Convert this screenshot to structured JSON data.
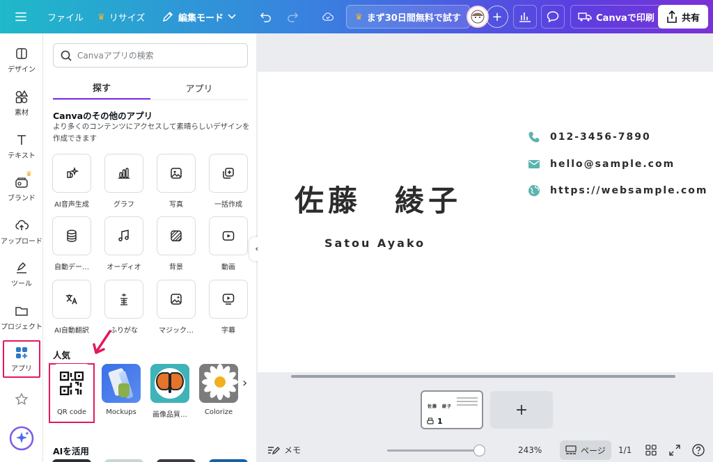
{
  "topbar": {
    "file": "ファイル",
    "resize": "リサイズ",
    "edit_mode": "編集モード",
    "trial": "まず30日間無料で試す",
    "print": "Canvaで印刷",
    "share": "共有"
  },
  "sidebar": {
    "items": [
      {
        "label": "デザイン"
      },
      {
        "label": "素材"
      },
      {
        "label": "テキスト"
      },
      {
        "label": "ブランド"
      },
      {
        "label": "アップロード"
      },
      {
        "label": "ツール"
      },
      {
        "label": "プロジェクト"
      },
      {
        "label": "アプリ"
      }
    ]
  },
  "panel": {
    "search_placeholder": "Canvaアプリの検索",
    "tabs": [
      {
        "label": "探す",
        "active": true
      },
      {
        "label": "アプリ",
        "active": false
      }
    ],
    "other_apps_title": "Canvaのその他のアプリ",
    "other_apps_desc": "より多くのコンテンツにアクセスして素晴らしいデザインを作成できます",
    "apps": [
      {
        "label": "AI音声生成"
      },
      {
        "label": "グラフ"
      },
      {
        "label": "写真"
      },
      {
        "label": "一括作成"
      },
      {
        "label": "自動デー…"
      },
      {
        "label": "オーディオ"
      },
      {
        "label": "背景"
      },
      {
        "label": "動画"
      },
      {
        "label": "AI自動翻訳"
      },
      {
        "label": "ふりがな"
      },
      {
        "label": "マジック…"
      },
      {
        "label": "字幕"
      }
    ],
    "popular_title": "人気",
    "popular": [
      {
        "label": "QR code"
      },
      {
        "label": "Mockups"
      },
      {
        "label": "画像品質…"
      },
      {
        "label": "Colorize"
      }
    ],
    "ai_title": "AIを活用"
  },
  "card": {
    "name": "佐藤　綾子",
    "romaji": "Satou Ayako",
    "phone": "012-3456-7890",
    "email": "hello@sample.com",
    "website": "https://websample.com"
  },
  "pages": {
    "thumb_number": "1"
  },
  "bottombar": {
    "notes": "メモ",
    "zoom": "243%",
    "page_view": "ページ",
    "page_count": "1/1"
  },
  "colors": {
    "accent": "#7d2ae8",
    "highlight": "#e2195a",
    "contact_icon": "#5bb3ad"
  }
}
